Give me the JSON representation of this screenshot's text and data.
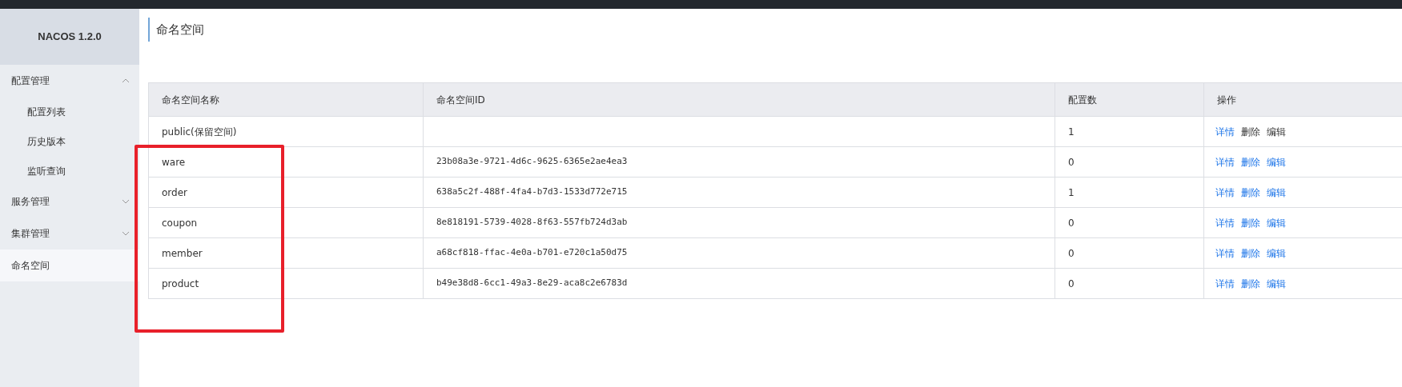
{
  "sidebar": {
    "logo": "NACOS 1.2.0",
    "items": [
      {
        "label": "配置管理",
        "selected": false,
        "expanded": true,
        "children": [
          {
            "label": "配置列表",
            "selected": false
          },
          {
            "label": "历史版本",
            "selected": false
          },
          {
            "label": "监听查询",
            "selected": false
          }
        ]
      },
      {
        "label": "服务管理",
        "selected": false,
        "expanded": false
      },
      {
        "label": "集群管理",
        "selected": false,
        "expanded": false
      },
      {
        "label": "命名空间",
        "selected": true
      }
    ]
  },
  "page_title": "命名空间",
  "table": {
    "columns": [
      "命名空间名称",
      "命名空间ID",
      "配置数",
      "操作"
    ],
    "rows": [
      {
        "name": "public(保留空间)",
        "id": "",
        "count": "1",
        "actions": [
          {
            "label": "详情",
            "disabled": false
          },
          {
            "label": "删除",
            "disabled": true
          },
          {
            "label": "编辑",
            "disabled": true
          }
        ]
      },
      {
        "name": "ware",
        "id": "23b08a3e-9721-4d6c-9625-6365e2ae4ea3",
        "count": "0",
        "actions": [
          {
            "label": "详情",
            "disabled": false
          },
          {
            "label": "删除",
            "disabled": false
          },
          {
            "label": "编辑",
            "disabled": false
          }
        ]
      },
      {
        "name": "order",
        "id": "638a5c2f-488f-4fa4-b7d3-1533d772e715",
        "count": "1",
        "actions": [
          {
            "label": "详情",
            "disabled": false
          },
          {
            "label": "删除",
            "disabled": false
          },
          {
            "label": "编辑",
            "disabled": false
          }
        ]
      },
      {
        "name": "coupon",
        "id": "8e818191-5739-4028-8f63-557fb724d3ab",
        "count": "0",
        "actions": [
          {
            "label": "详情",
            "disabled": false
          },
          {
            "label": "删除",
            "disabled": false
          },
          {
            "label": "编辑",
            "disabled": false
          }
        ]
      },
      {
        "name": "member",
        "id": "a68cf818-ffac-4e0a-b701-e720c1a50d75",
        "count": "0",
        "actions": [
          {
            "label": "详情",
            "disabled": false
          },
          {
            "label": "删除",
            "disabled": false
          },
          {
            "label": "编辑",
            "disabled": false
          }
        ]
      },
      {
        "name": "product",
        "id": "b49e38d8-6cc1-49a3-8e29-aca8c2e6783d",
        "count": "0",
        "actions": [
          {
            "label": "详情",
            "disabled": false
          },
          {
            "label": "删除",
            "disabled": false
          },
          {
            "label": "编辑",
            "disabled": false
          }
        ]
      }
    ]
  }
}
